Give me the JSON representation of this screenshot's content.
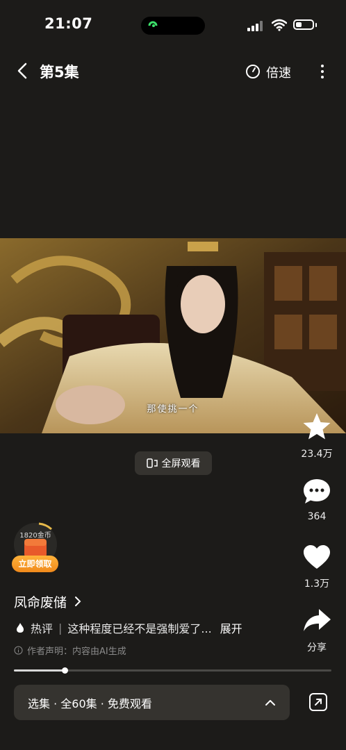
{
  "status_bar": {
    "time": "21:07"
  },
  "nav": {
    "title": "第5集",
    "speed_label": "倍速"
  },
  "video": {
    "subtitle": "那使挑一个"
  },
  "fullscreen": {
    "label": "全屏观看"
  },
  "rail": {
    "favorite_count": "23.4万",
    "comment_count": "364",
    "like_count": "1.3万",
    "share_label": "分享"
  },
  "coin": {
    "amount": "1820金币",
    "button": "立即领取"
  },
  "series": {
    "title": "凤命废储",
    "hot_label": "热评",
    "hot_comment": "这种程度已经不是强制爱了...",
    "expand": "展开",
    "disclaimer": "作者声明：内容由AI生成"
  },
  "playback": {
    "progress": 0.16
  },
  "episodes": {
    "label": "选集 · 全60集 · 免费观看"
  },
  "colors": {
    "background": "#1c1b19",
    "panel": "#35332f",
    "accent": "#f08a1c"
  }
}
